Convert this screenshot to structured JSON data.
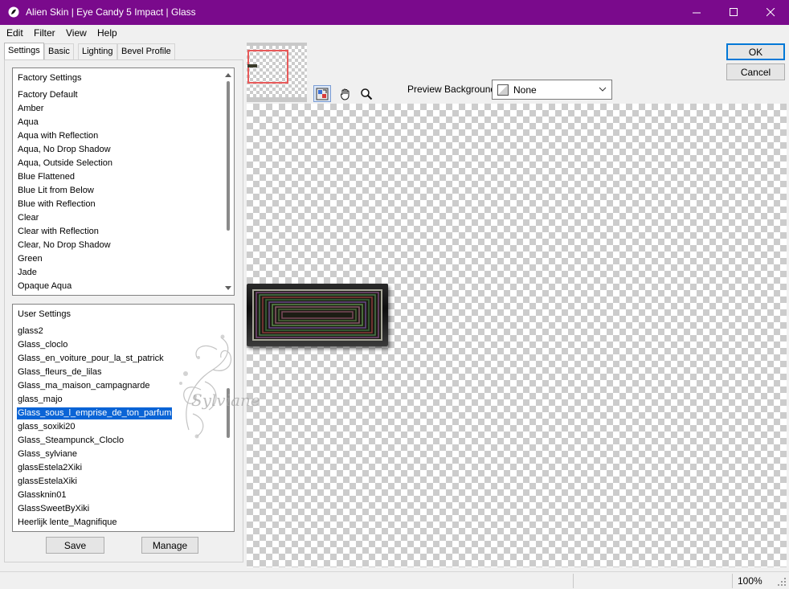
{
  "window": {
    "title": "Alien Skin | Eye Candy 5 Impact | Glass",
    "titlebar_color": "#7a0a8c"
  },
  "menu": [
    "Edit",
    "Filter",
    "View",
    "Help"
  ],
  "tabs": [
    "Settings",
    "Basic",
    "Lighting",
    "Bevel Profile"
  ],
  "factory_settings": {
    "header": "Factory Settings",
    "items": [
      "Factory Default",
      "Amber",
      "Aqua",
      "Aqua with Reflection",
      "Aqua, No Drop Shadow",
      "Aqua, Outside Selection",
      "Blue Flattened",
      "Blue Lit from Below",
      "Blue with Reflection",
      "Clear",
      "Clear with Reflection",
      "Clear, No Drop Shadow",
      "Green",
      "Jade",
      "Opaque Aqua"
    ]
  },
  "user_settings": {
    "header": "User Settings",
    "items": [
      "glass2",
      "Glass_cloclo",
      "Glass_en_voiture_pour_la_st_patrick",
      "Glass_fleurs_de_lilas",
      "Glass_ma_maison_campagnarde",
      "glass_majo",
      "Glass_sous_l_emprise_de_ton_parfum",
      "glass_soxiki20",
      "Glass_Steampunck_Cloclo",
      "Glass_sylviane",
      "glassEstela2Xiki",
      "glassEstelaXiki",
      "Glassknin01",
      "GlassSweetByXiki",
      "Heerlijk lente_Magnifique"
    ],
    "selected": "Glass_sous_l_emprise_de_ton_parfum"
  },
  "buttons": {
    "save": "Save",
    "manage": "Manage",
    "ok": "OK",
    "cancel": "Cancel"
  },
  "preview": {
    "background_label": "Preview Background:",
    "background_value": "None"
  },
  "watermark_text": "Sylviane",
  "status": {
    "zoom": "100%"
  },
  "colors": {
    "selection": "#0a64d6",
    "nav_frame": "#e85a5a"
  }
}
